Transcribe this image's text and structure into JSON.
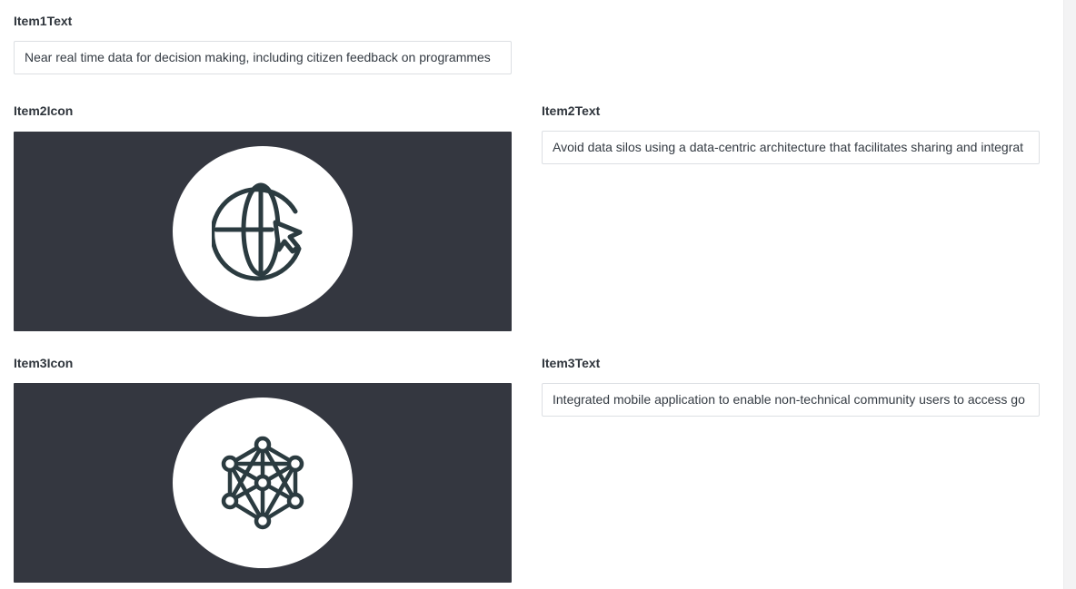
{
  "item1": {
    "text_label": "Item1Text",
    "text_value": "Near real time data for decision making, including citizen feedback on programmes"
  },
  "item2": {
    "icon_label": "Item2Icon",
    "icon_name": "globe-cursor-icon",
    "text_label": "Item2Text",
    "text_value": "Avoid data silos using a data-centric architecture that facilitates sharing and integrat"
  },
  "item3": {
    "icon_label": "Item3Icon",
    "icon_name": "network-nodes-icon",
    "text_label": "Item3Text",
    "text_value": "Integrated mobile application to enable non-technical community users to access go"
  },
  "colors": {
    "image_background": "#343740",
    "icon_stroke": "#2b3b40",
    "circle_fill": "#ffffff"
  }
}
